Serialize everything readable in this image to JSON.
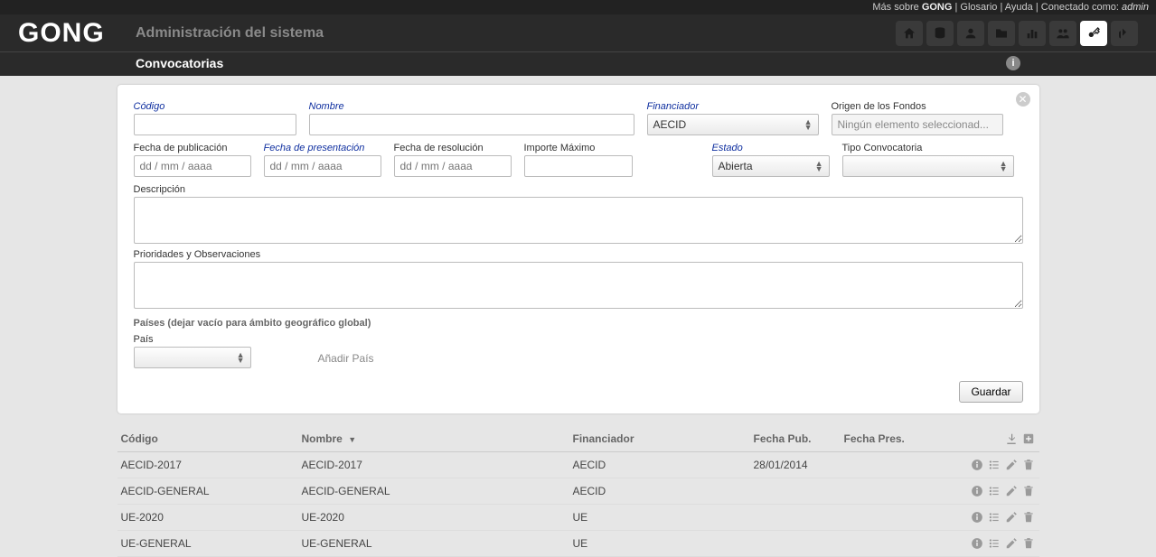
{
  "topbar": {
    "mas_sobre": "Más sobre",
    "brand": "GONG",
    "glosario": "Glosario",
    "ayuda": "Ayuda",
    "conectado": "Conectado como:",
    "user": "admin"
  },
  "header": {
    "logo": "GONG",
    "title": "Administración del sistema",
    "subtitle": "Convocatorias"
  },
  "nav_icons": [
    "home-icon",
    "database-icon",
    "user-icon",
    "folder-icon",
    "chart-icon",
    "users-icon",
    "key-icon",
    "exit-icon"
  ],
  "form": {
    "codigo_label": "Código",
    "nombre_label": "Nombre",
    "financiador_label": "Financiador",
    "financiador_value": "AECID",
    "origen_label": "Origen de los Fondos",
    "origen_placeholder": "Ningún elemento seleccionad...",
    "fpub_label": "Fecha de publicación",
    "fpres_label": "Fecha de presentación",
    "fres_label": "Fecha de resolución",
    "date_placeholder": "dd / mm / aaaa",
    "importe_label": "Importe Máximo",
    "estado_label": "Estado",
    "estado_value": "Abierta",
    "tipo_label": "Tipo Convocatoria",
    "descripcion_label": "Descripción",
    "prioridades_label": "Prioridades y Observaciones",
    "paises_section": "Países (dejar vacío para ámbito geográfico global)",
    "pais_label": "País",
    "anadir_pais": "Añadir País",
    "guardar": "Guardar"
  },
  "table": {
    "headers": {
      "codigo": "Código",
      "nombre": "Nombre",
      "financiador": "Financiador",
      "fpub": "Fecha Pub.",
      "fpres": "Fecha Pres."
    },
    "rows": [
      {
        "codigo": "AECID-2017",
        "nombre": "AECID-2017",
        "fin": "AECID",
        "fpub": "28/01/2014",
        "fpres": ""
      },
      {
        "codigo": "AECID-GENERAL",
        "nombre": "AECID-GENERAL",
        "fin": "AECID",
        "fpub": "",
        "fpres": ""
      },
      {
        "codigo": "UE-2020",
        "nombre": "UE-2020",
        "fin": "UE",
        "fpub": "",
        "fpres": ""
      },
      {
        "codigo": "UE-GENERAL",
        "nombre": "UE-GENERAL",
        "fin": "UE",
        "fpub": "",
        "fpres": ""
      }
    ]
  }
}
